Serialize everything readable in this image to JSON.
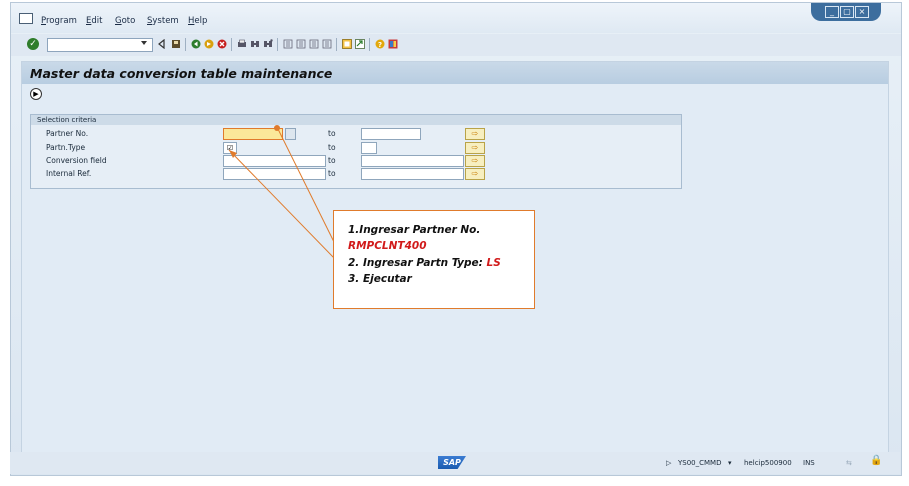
{
  "menu": {
    "items": [
      "Program",
      "Edit",
      "Goto",
      "System",
      "Help"
    ]
  },
  "window": {
    "controls": [
      "_",
      "▢",
      "×"
    ]
  },
  "page": {
    "title": "Master data conversion table maintenance"
  },
  "selection": {
    "header": "Selection criteria",
    "to_label": "to",
    "rows": [
      {
        "label": "Partner No."
      },
      {
        "label": "Partn.Type"
      },
      {
        "label": "Conversion field"
      },
      {
        "label": "Internal Ref."
      }
    ]
  },
  "callout": {
    "line1": "1.Ingresar Partner No.",
    "line2": "RMPCLNT400",
    "line3_prefix": "2. Ingresar Partn Type: ",
    "line3_value": "LS",
    "line4": "3. Ejecutar"
  },
  "status": {
    "logo": "SAP",
    "system": "YS00_CMMD",
    "server": "helcip500900",
    "mode": "INS"
  },
  "colors": {
    "accent": "#e07b2c",
    "highlight": "#d11a1a",
    "required_field": "#fbe89a"
  }
}
